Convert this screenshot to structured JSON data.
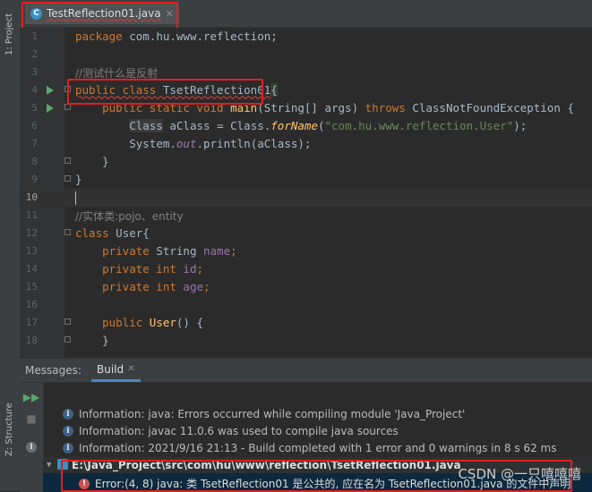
{
  "tab": {
    "filename": "TestReflection01.java",
    "close": "✕"
  },
  "left_strip": {
    "project": "1: Project",
    "structure": "Z: Structure"
  },
  "editor": {
    "lines": [
      {
        "n": "1"
      },
      {
        "n": "2"
      },
      {
        "n": "3"
      },
      {
        "n": "4"
      },
      {
        "n": "5"
      },
      {
        "n": "6"
      },
      {
        "n": "7"
      },
      {
        "n": "8"
      },
      {
        "n": "9"
      },
      {
        "n": "10"
      },
      {
        "n": "11"
      },
      {
        "n": "12"
      },
      {
        "n": "13"
      },
      {
        "n": "14"
      },
      {
        "n": "15"
      },
      {
        "n": "16"
      },
      {
        "n": "17"
      },
      {
        "n": "18"
      }
    ],
    "code": {
      "l1_kw": "package",
      "l1_rest": " com.hu.www.reflection;",
      "l3": "//测试什么是反射",
      "l4_kw": "public class",
      "l4_name": " TsetReflection01",
      "l4_brace": "{",
      "l5_kw1": "    public static void",
      "l5_fn": " main",
      "l5_args": "(String[] args)",
      "l5_kw2": " throws",
      "l5_rest": " ClassNotFoundException {",
      "l6_cls": "Class",
      "l6_mid": " aClass = Class.",
      "l6_method": "forName",
      "l6_open": "(",
      "l6_str": "\"com.hu.www.reflection.User\"",
      "l6_close": ");",
      "l7_a": "System.",
      "l7_out": "out",
      "l7_b": ".println(aClass);",
      "l8": "    }",
      "l9": "}",
      "l11": "//实体类:pojo、entity",
      "l12_kw": "class",
      "l12_rest": " User{",
      "l13_kw": "    private",
      "l13_type": " String",
      "l13_fld": " name",
      "l13_end": ";",
      "l14_kw": "    private int",
      "l14_fld": " id",
      "l14_end": ";",
      "l15_kw": "    private int",
      "l15_fld": " age",
      "l15_end": ";",
      "l17_kw": "    public",
      "l17_fn": " User",
      "l17_rest": "() {",
      "l18": "    }"
    }
  },
  "bottom": {
    "messages_label": "Messages:",
    "build_tab": "Build",
    "build_close": "✕",
    "info": [
      "Information: java: Errors occurred while compiling module 'Java_Project'",
      "Information: javac 11.0.6 was used to compile java sources",
      "Information: 2021/9/16 21:13 - Build completed with 1 error and 0 warnings in 8 s 62 ms"
    ],
    "path": "E:\\Java_Project\\src\\com\\hu\\www\\reflection\\TsetReflection01.java",
    "error": "Error:(4, 8)  java: 类 TsetReflection01 是公共的, 应在名为 TsetReflection01.java 的文件中声明"
  },
  "watermark": "CSDN @一只嘻嘻嘻",
  "colors": {
    "keyword": "#cc7832",
    "string": "#6a8759",
    "comment": "#808080",
    "highlight": "#e02020"
  }
}
